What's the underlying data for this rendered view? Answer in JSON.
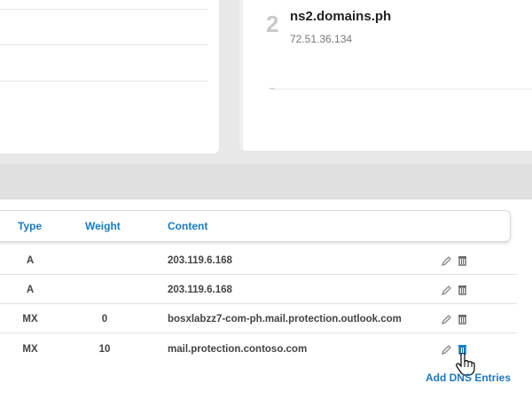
{
  "nameserver": {
    "number": "2",
    "name": "ns2.domains.ph",
    "ip": "72.51.36.134"
  },
  "table": {
    "headers": {
      "type": "Type",
      "weight": "Weight",
      "content": "Content"
    },
    "rows": [
      {
        "type": "A",
        "weight": "",
        "content": "203.119.6.168"
      },
      {
        "type": "A",
        "weight": "",
        "content": "203.119.6.168"
      },
      {
        "type": "MX",
        "weight": "0",
        "content": "bosxlabzz7-com-ph.mail.protection.outlook.com"
      },
      {
        "type": "MX",
        "weight": "10",
        "content": "mail.protection.contoso.com"
      }
    ],
    "row_actions": [
      "edit-icon",
      "delete-icon"
    ]
  },
  "add_link": "Add DNS Entries",
  "colors": {
    "accent": "#1a7ac2",
    "delete_hover": "#1a7ac2"
  }
}
